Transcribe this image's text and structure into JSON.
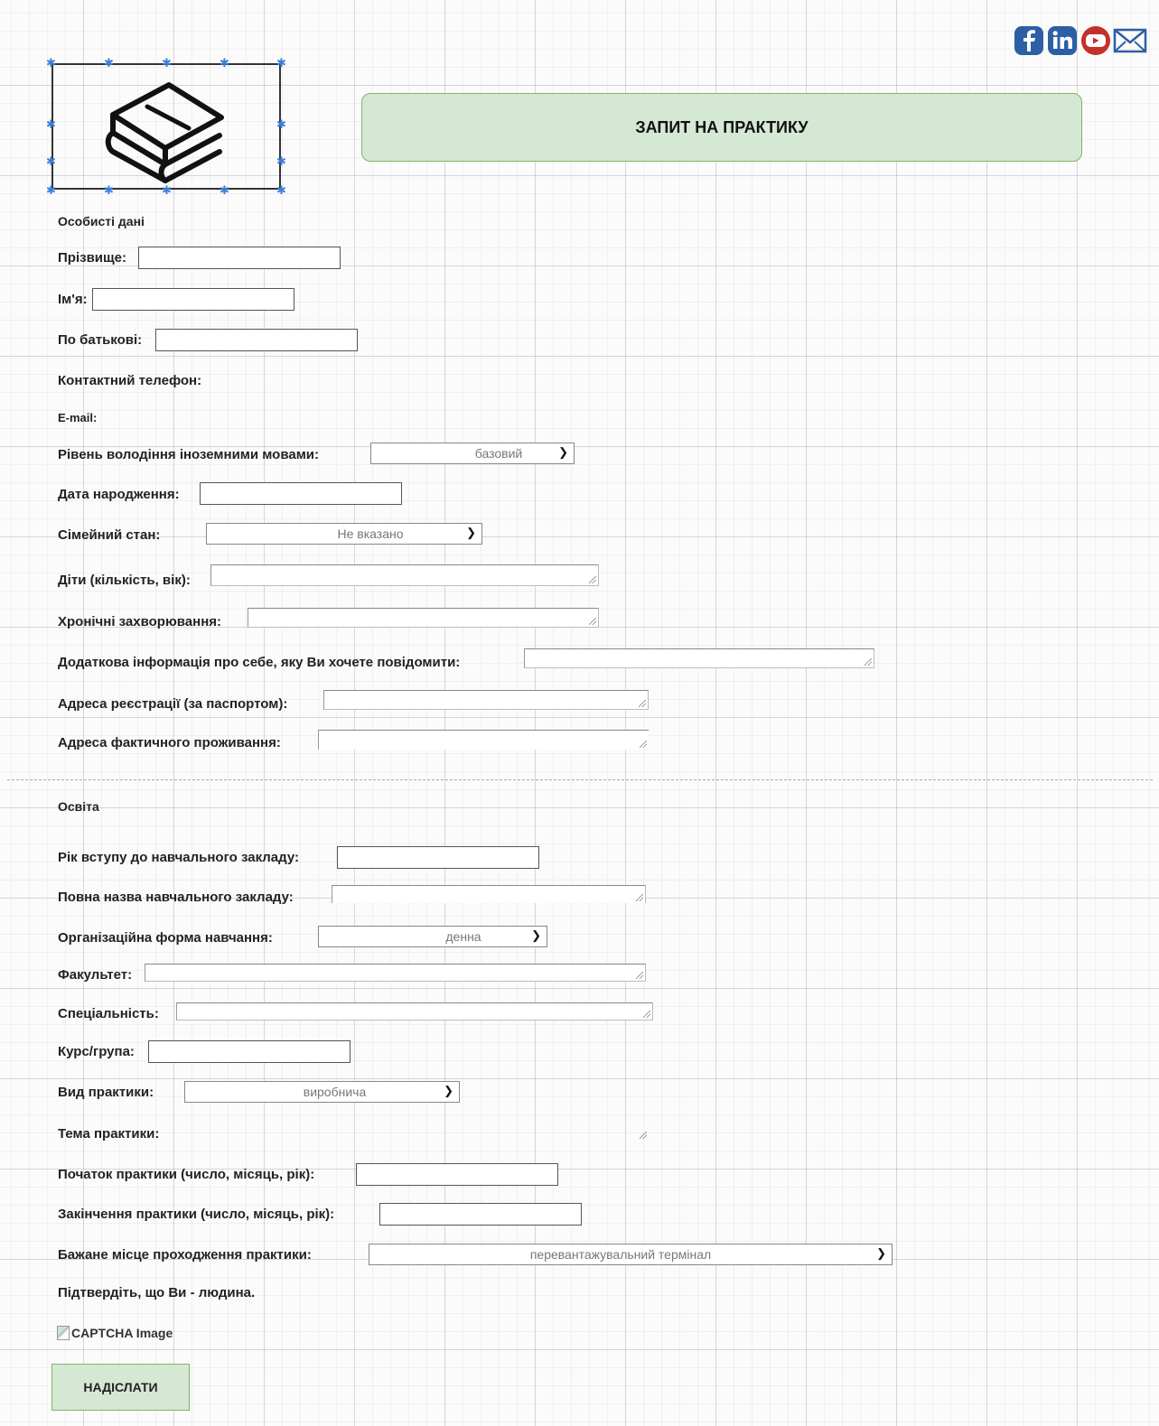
{
  "header": {
    "title": "ЗАПИТ НА ПРАКТИКУ",
    "social_icons": [
      "facebook-icon",
      "linkedin-icon",
      "youtube-icon",
      "email-icon"
    ],
    "accent_color": "#d5e8d4",
    "accent_border": "#82b366"
  },
  "personal": {
    "section_title": "Особисті дані",
    "surname_label": "Прізвище:",
    "name_label": "Ім'я:",
    "patronymic_label": "По батькові:",
    "phone_label": "Контактний телефон:",
    "email_label": "E-mail:",
    "languages_label": "Рівень володіння іноземними мовами:",
    "languages_value": "базовий",
    "birthdate_label": "Дата народження:",
    "marital_label": "Сімейний стан:",
    "marital_value": "Не вказано",
    "children_label": "Діти (кількість, вік):",
    "diseases_label": "Хронічні захворювання:",
    "extra_info_label": "Додаткова інформація про себе, яку Ви хочете повідомити:",
    "reg_address_label": "Адреса реєстрації (за паспортом):",
    "actual_address_label": "Адреса фактичного проживання:"
  },
  "education": {
    "section_title": "Освіта",
    "entry_year_label": "Рік вступу до навчального закладу:",
    "institution_label": "Повна назва навчального закладу:",
    "study_form_label": "Організаційна форма навчання:",
    "study_form_value": "денна",
    "faculty_label": "Факультет:",
    "specialty_label": "Спеціальність:",
    "course_group_label": "Курс/група:",
    "practice_type_label": "Вид практики:",
    "practice_type_value": "виробнича",
    "practice_topic_label": "Тема практики:",
    "start_label": "Початок практики (число, місяць, рік):",
    "end_label": "Закінчення практики (число, місяць, рік):",
    "place_label": "Бажане місце проходження практики:",
    "place_value": "перевантажувальний термінал",
    "captcha_prompt": "Підтвердіть, що Ви - людина.",
    "captcha_alt": "CAPTCHA Image",
    "submit_label": "НАДІСЛАТИ"
  }
}
